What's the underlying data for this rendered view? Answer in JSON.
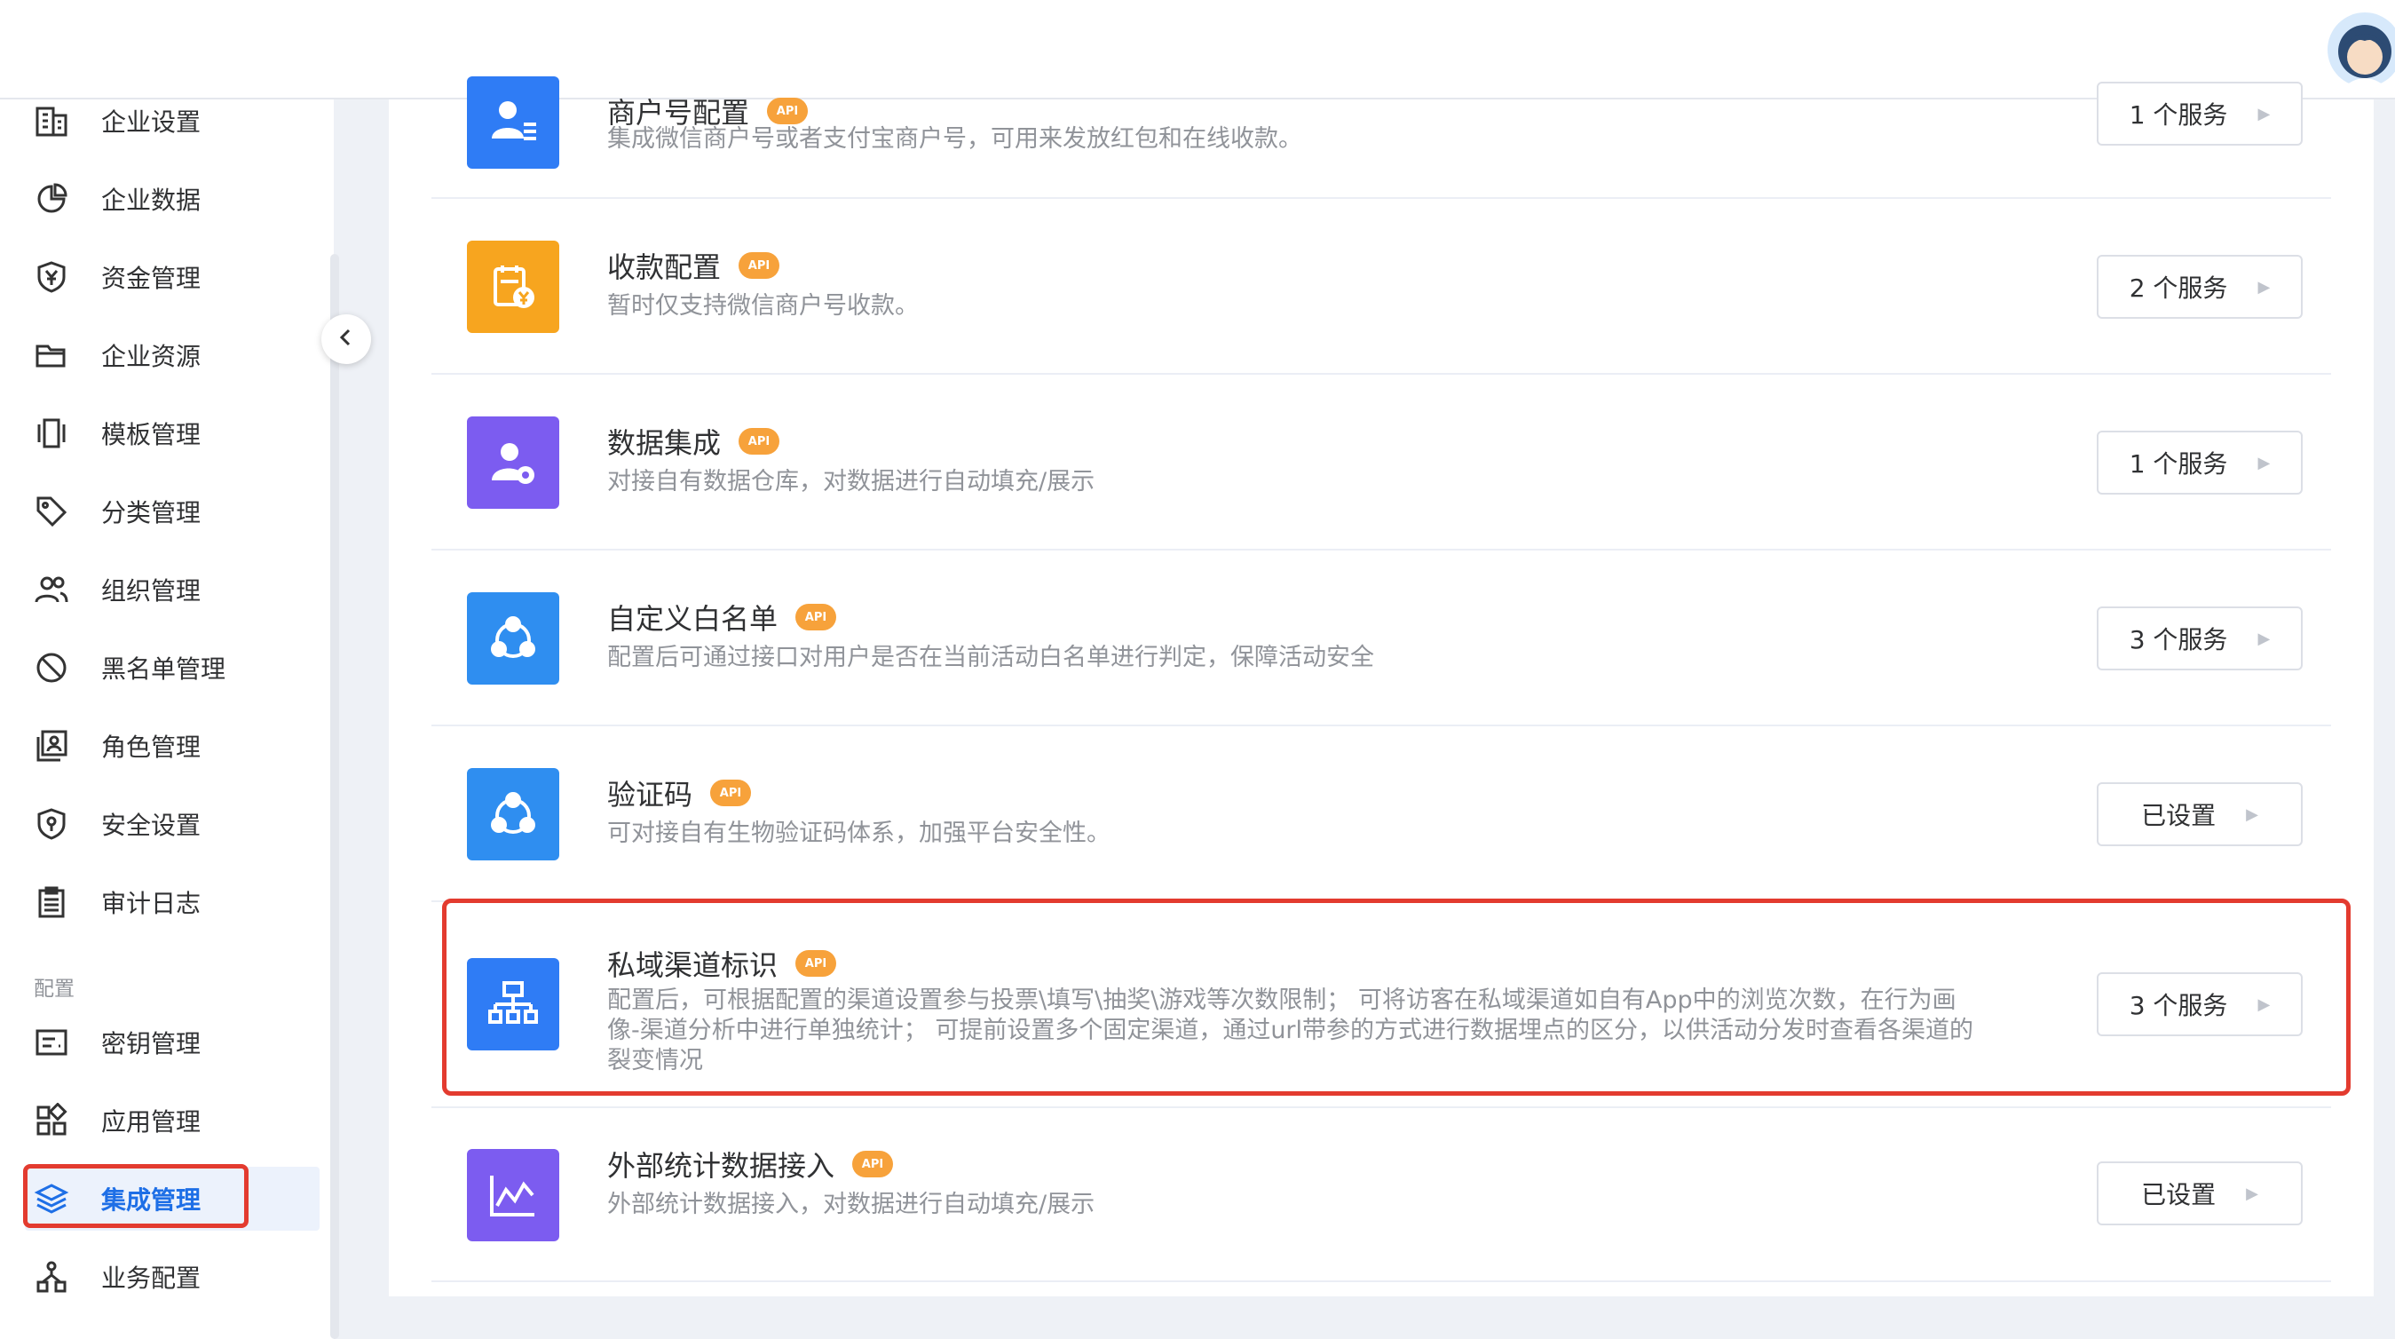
{
  "sidebar": {
    "items": [
      {
        "label": "企业设置",
        "icon": "building-icon"
      },
      {
        "label": "企业数据",
        "icon": "pie-chart-icon"
      },
      {
        "label": "资金管理",
        "icon": "yuan-shield-icon"
      },
      {
        "label": "企业资源",
        "icon": "folder-icon"
      },
      {
        "label": "模板管理",
        "icon": "template-icon"
      },
      {
        "label": "分类管理",
        "icon": "tag-icon"
      },
      {
        "label": "组织管理",
        "icon": "users-icon"
      },
      {
        "label": "黑名单管理",
        "icon": "block-icon"
      },
      {
        "label": "角色管理",
        "icon": "id-card-icon"
      },
      {
        "label": "安全设置",
        "icon": "shield-icon"
      },
      {
        "label": "审计日志",
        "icon": "clipboard-icon"
      }
    ],
    "group_label": "配置",
    "config_items": [
      {
        "label": "密钥管理",
        "icon": "key-card-icon"
      },
      {
        "label": "应用管理",
        "icon": "apps-icon"
      },
      {
        "label": "集成管理",
        "icon": "layers-icon"
      },
      {
        "label": "业务配置",
        "icon": "network-icon"
      }
    ]
  },
  "integrations": [
    {
      "title": "商户号配置",
      "desc": "集成微信商户号或者支付宝商户号，可用来发放红包和在线收款。",
      "button": "1 个服务",
      "color": "#2f7cf5",
      "icon": "merchant-icon"
    },
    {
      "title": "收款配置",
      "api": "API",
      "desc": "暂时仅支持微信商户号收款。",
      "button": "2 个服务",
      "color": "#f7a51f",
      "icon": "payment-icon"
    },
    {
      "title": "数据集成",
      "api": "API",
      "desc": "对接自有数据仓库，对数据进行自动填充/展示",
      "button": "1 个服务",
      "color": "#7c5cf0",
      "icon": "user-gear-icon"
    },
    {
      "title": "自定义白名单",
      "api": "API",
      "desc": "配置后可通过接口对用户是否在当前活动白名单进行判定，保障活动安全",
      "button": "3 个服务",
      "color": "#2f8ef0",
      "icon": "share-icon"
    },
    {
      "title": "验证码",
      "api": "API",
      "desc": "可对接自有生物验证码体系，加强平台安全性。",
      "button": "已设置",
      "color": "#2f8ef0",
      "icon": "share-icon"
    },
    {
      "title": "私域渠道标识",
      "api": "API",
      "desc": "配置后，可根据配置的渠道设置参与投票\\填写\\抽奖\\游戏等次数限制； 可将访客在私域渠道如自有App中的浏览次数，在行为画像-渠道分析中进行单独统计； 可提前设置多个固定渠道，通过url带参的方式进行数据埋点的区分，以供活动分发时查看各渠道的裂变情况",
      "button": "3 个服务",
      "color": "#2f7cf5",
      "icon": "hierarchy-icon"
    },
    {
      "title": "外部统计数据接入",
      "api": "API",
      "desc": "外部统计数据接入，对数据进行自动填充/展示",
      "button": "已设置",
      "color": "#7c5cf0",
      "icon": "line-chart-icon"
    }
  ]
}
